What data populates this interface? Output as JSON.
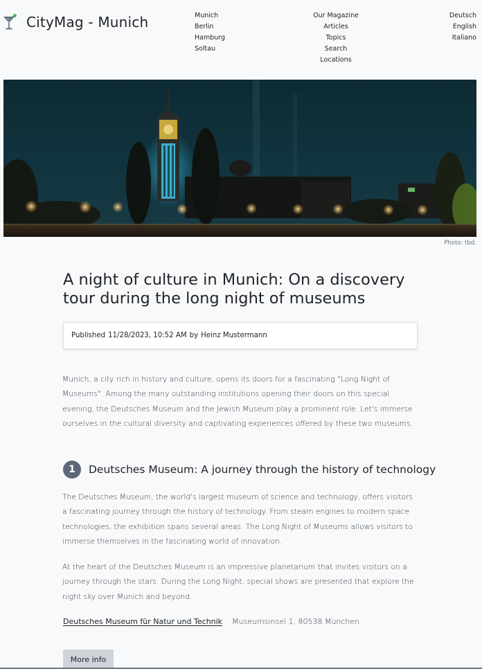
{
  "brand": {
    "name": "CityMag - Munich",
    "icon": "cocktail-glass-icon"
  },
  "nav": {
    "cities": [
      "Munich",
      "Berlin",
      "Hamburg",
      "Soltau"
    ],
    "magazine": [
      "Our Magazine",
      "Articles",
      "Topics",
      "Search",
      "Locations"
    ],
    "languages": [
      "Deutsch",
      "English",
      "Italiano"
    ]
  },
  "hero": {
    "caption": "Photo: tbd."
  },
  "article": {
    "title": "A night of culture in Munich: On a discovery tour during the long night of museums",
    "published_prefix": "Published",
    "published_date": "11/28/2023, 10:52 AM",
    "published_by": "by",
    "author": "Heinz Mustermann",
    "intro": "Munich, a city rich in history and culture, opens its doors for a fascinating \"Long Night of Museums\". Among the many outstanding institutions opening their doors on this special evening, the Deutsches Museum and the Jewish Museum play a prominent role. Let's immerse ourselves in the cultural diversity and captivating experiences offered by these two museums.",
    "sections": [
      {
        "number": "1",
        "title": "Deutsches Museum: A journey through the history of technology",
        "paragraphs": [
          "The Deutsches Museum, the world's largest museum of science and technology, offers visitors a fascinating journey through the history of technology. From steam engines to modern space technologies, the exhibition spans several areas. The Long Night of Museums allows visitors to immerse themselves in the fascinating world of innovation.",
          "At the heart of the Deutsches Museum is an impressive planetarium that invites visitors on a journey through the stars. During the Long Night, special shows are presented that explore the night sky over Munich and beyond."
        ],
        "location_name": "Deutsches Museum für Natur und Technik",
        "location_address": "Museumsinsel 1, 80538 München",
        "button_label": "More info"
      }
    ]
  },
  "colors": {
    "background": "#f8f9fa",
    "badge": "#5c6778",
    "button": "#ced4da",
    "text": "#212529",
    "muted": "#6c757d"
  }
}
